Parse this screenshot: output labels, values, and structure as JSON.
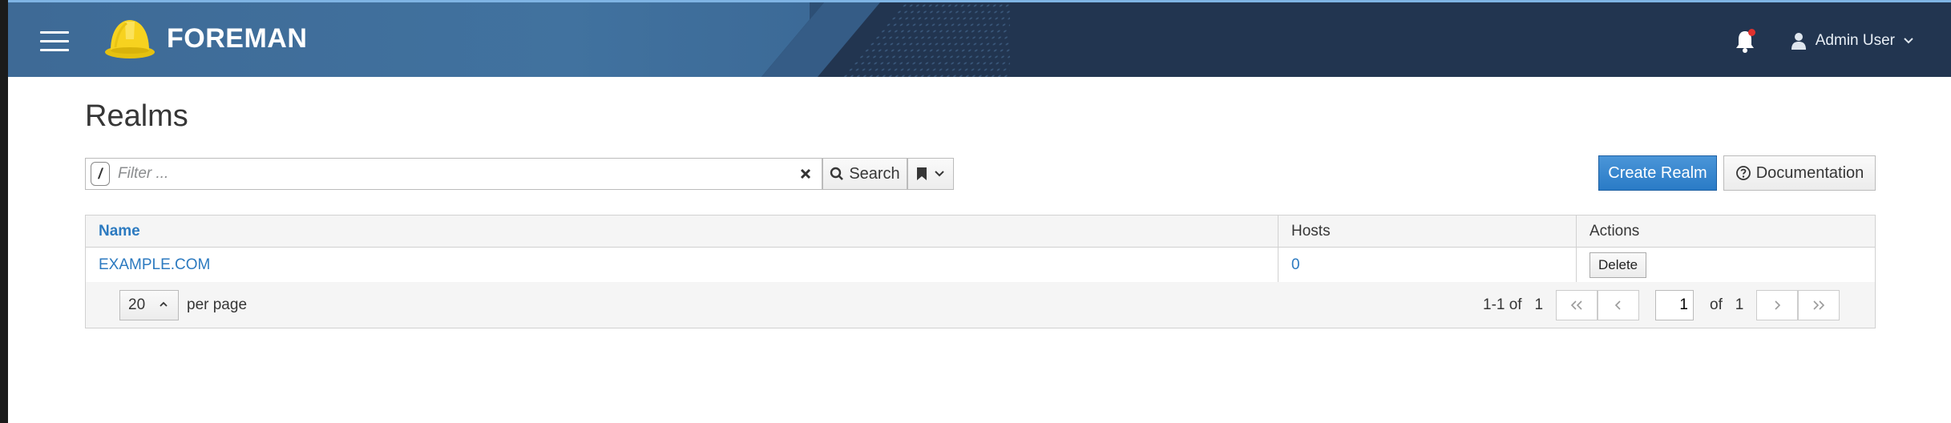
{
  "app": {
    "brand": "FOREMAN"
  },
  "navbar": {
    "user_name": "Admin User"
  },
  "page": {
    "title": "Realms"
  },
  "search": {
    "placeholder": "Filter ...",
    "slash": "/",
    "button_label": "Search"
  },
  "actions": {
    "create_label": "Create Realm",
    "documentation_label": "Documentation"
  },
  "table": {
    "headers": {
      "name": "Name",
      "hosts": "Hosts",
      "actions": "Actions"
    },
    "rows": [
      {
        "name": "EXAMPLE.COM",
        "hosts": "0",
        "action": "Delete"
      }
    ]
  },
  "pagination": {
    "per_page_value": "20",
    "per_page_label": "per page",
    "range": "1-1 of",
    "range_total": "1",
    "current_page": "1",
    "of_label": "of",
    "total_pages": "1"
  },
  "colors": {
    "primary": "#2a7bc6",
    "link": "#2c7ac0",
    "navbar_dark": "#223550",
    "navbar_light": "#41729f",
    "notification_dot": "#e0312e"
  }
}
